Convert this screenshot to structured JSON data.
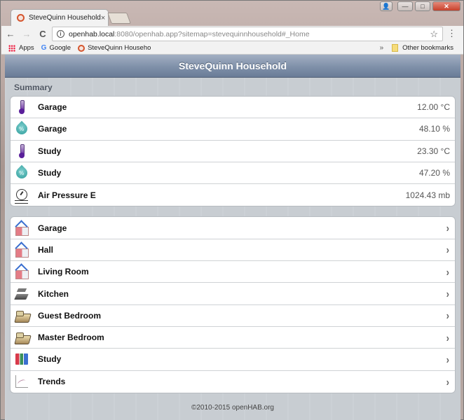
{
  "browser": {
    "tab_title": "SteveQuinn Household",
    "tab_close": "×",
    "url_host": "openhab.local",
    "url_rest": ":8080/openhab.app?sitemap=stevequinnhousehold#_Home",
    "nav_back": "←",
    "nav_forward": "→",
    "nav_reload": "C",
    "info_icon": "i",
    "star_icon": "☆",
    "menu_icon": "⋮",
    "window_controls": {
      "user": "👤",
      "minimize": "—",
      "maximize": "□",
      "close": "✕"
    },
    "bookmarks": {
      "apps": "Apps",
      "google_g": "G",
      "google": "Google",
      "stevequinn": "SteveQuinn Househo",
      "overflow": "»",
      "other": "Other bookmarks"
    }
  },
  "header": {
    "title": "SteveQuinn Household"
  },
  "summary": {
    "label": "Summary",
    "items": [
      {
        "icon": "thermometer-icon",
        "label": "Garage",
        "value": "12.00 °C"
      },
      {
        "icon": "humidity-icon",
        "label": "Garage",
        "value": "48.10 %"
      },
      {
        "icon": "thermometer-icon",
        "label": "Study",
        "value": "23.30 °C"
      },
      {
        "icon": "humidity-icon",
        "label": "Study",
        "value": "47.20 %"
      },
      {
        "icon": "pressure-gauge-icon",
        "label": "Air Pressure E",
        "value": "1024.43 mb"
      }
    ]
  },
  "rooms": {
    "arrow": "›",
    "items": [
      {
        "icon": "house-icon",
        "label": "Garage"
      },
      {
        "icon": "house-icon",
        "label": "Hall"
      },
      {
        "icon": "house-icon",
        "label": "Living Room"
      },
      {
        "icon": "kitchen-icon",
        "label": "Kitchen"
      },
      {
        "icon": "bed-icon",
        "label": "Guest Bedroom"
      },
      {
        "icon": "bed-icon",
        "label": "Master Bedroom"
      },
      {
        "icon": "books-icon",
        "label": "Study"
      },
      {
        "icon": "trend-chart-icon",
        "label": "Trends"
      }
    ]
  },
  "footer": {
    "text": "©2010-2015 openHAB.org"
  }
}
